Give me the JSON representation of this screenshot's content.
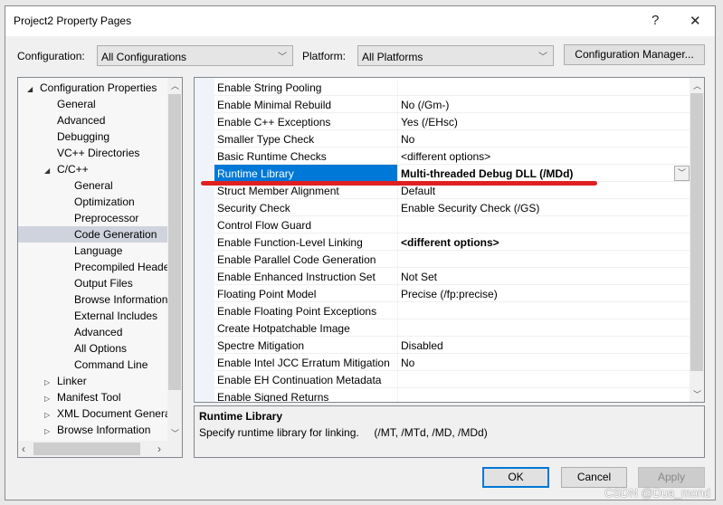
{
  "window": {
    "title": "Project2 Property Pages",
    "help": "?",
    "close": "✕"
  },
  "toolbar": {
    "config_label": "Configuration:",
    "config_value": "All Configurations",
    "platform_label": "Platform:",
    "platform_value": "All Platforms",
    "config_manager": "Configuration Manager..."
  },
  "tree": [
    {
      "label": "Configuration Properties",
      "level": 0,
      "expander": "◢"
    },
    {
      "label": "General",
      "level": 1
    },
    {
      "label": "Advanced",
      "level": 1
    },
    {
      "label": "Debugging",
      "level": 1
    },
    {
      "label": "VC++ Directories",
      "level": 1
    },
    {
      "label": "C/C++",
      "level": 1,
      "expander": "◢"
    },
    {
      "label": "General",
      "level": 2
    },
    {
      "label": "Optimization",
      "level": 2
    },
    {
      "label": "Preprocessor",
      "level": 2
    },
    {
      "label": "Code Generation",
      "level": 2,
      "selected": true
    },
    {
      "label": "Language",
      "level": 2
    },
    {
      "label": "Precompiled Heade",
      "level": 2
    },
    {
      "label": "Output Files",
      "level": 2
    },
    {
      "label": "Browse Information",
      "level": 2
    },
    {
      "label": "External Includes",
      "level": 2
    },
    {
      "label": "Advanced",
      "level": 2
    },
    {
      "label": "All Options",
      "level": 2
    },
    {
      "label": "Command Line",
      "level": 2
    },
    {
      "label": "Linker",
      "level": 1,
      "expander": "▷"
    },
    {
      "label": "Manifest Tool",
      "level": 1,
      "expander": "▷"
    },
    {
      "label": "XML Document Genera",
      "level": 1,
      "expander": "▷"
    },
    {
      "label": "Browse Information",
      "level": 1,
      "expander": "▷"
    }
  ],
  "properties": [
    {
      "name": "Enable String Pooling",
      "value": ""
    },
    {
      "name": "Enable Minimal Rebuild",
      "value": "No (/Gm-)"
    },
    {
      "name": "Enable C++ Exceptions",
      "value": "Yes (/EHsc)"
    },
    {
      "name": "Smaller Type Check",
      "value": "No"
    },
    {
      "name": "Basic Runtime Checks",
      "value": "<different options>"
    },
    {
      "name": "Runtime Library",
      "value": "Multi-threaded Debug DLL (/MDd)",
      "selected": true,
      "bold": true
    },
    {
      "name": "Struct Member Alignment",
      "value": "Default"
    },
    {
      "name": "Security Check",
      "value": "Enable Security Check (/GS)"
    },
    {
      "name": "Control Flow Guard",
      "value": ""
    },
    {
      "name": "Enable Function-Level Linking",
      "value": "<different options>",
      "bold": true
    },
    {
      "name": "Enable Parallel Code Generation",
      "value": ""
    },
    {
      "name": "Enable Enhanced Instruction Set",
      "value": "Not Set"
    },
    {
      "name": "Floating Point Model",
      "value": "Precise (/fp:precise)"
    },
    {
      "name": "Enable Floating Point Exceptions",
      "value": ""
    },
    {
      "name": "Create Hotpatchable Image",
      "value": ""
    },
    {
      "name": "Spectre Mitigation",
      "value": "Disabled"
    },
    {
      "name": "Enable Intel JCC Erratum Mitigation",
      "value": "No"
    },
    {
      "name": "Enable EH Continuation Metadata",
      "value": ""
    },
    {
      "name": "Enable Signed Returns",
      "value": ""
    }
  ],
  "description": {
    "title": "Runtime Library",
    "text": "Specify runtime library for linking.     (/MT, /MTd, /MD, /MDd)"
  },
  "buttons": {
    "ok": "OK",
    "cancel": "Cancel",
    "apply": "Apply"
  },
  "watermark": "CSDN @Dua_mond",
  "colors": {
    "selection": "#0078d7",
    "annotation": "#e02020",
    "ok_border": "#0078d7"
  }
}
